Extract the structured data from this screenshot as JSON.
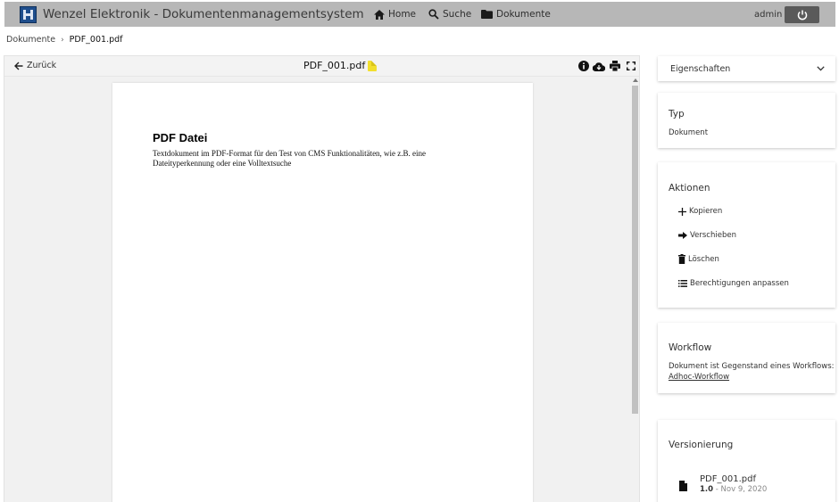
{
  "app": {
    "title": "Wenzel Elektronik - Dokumentenmanagementsystem",
    "nav": {
      "home": "Home",
      "search": "Suche",
      "documents": "Dokumente"
    },
    "user": "admin"
  },
  "breadcrumb": {
    "root": "Dokumente",
    "current": "PDF_001.pdf"
  },
  "viewer": {
    "back_label": "Zurück",
    "file_name": "PDF_001.pdf",
    "pdf": {
      "heading": "PDF Datei",
      "line1": "Textdokument im PDF-Format für den Test von CMS Funktionalitäten, wie z.B. eine",
      "line2": "Dateityperkennung oder eine Volltextsuche"
    }
  },
  "sidebar": {
    "properties_label": "Eigenschaften",
    "type": {
      "title": "Typ",
      "value": "Dokument"
    },
    "actions": {
      "title": "Aktionen",
      "copy": "Kopieren",
      "move": "Verschieben",
      "delete": "Löschen",
      "permissions": "Berechtigungen anpassen"
    },
    "workflow": {
      "title": "Workflow",
      "text": "Dokument ist Gegenstand eines Workflows:",
      "link": "Adhoc-Workflow"
    },
    "versions": {
      "title": "Versionierung",
      "file_name": "PDF_001.pdf",
      "version": "1.0",
      "separator": " - ",
      "date": "Nov 9, 2020"
    }
  },
  "colors": {
    "topbar": "#b7b7b7",
    "power_button": "#5a5a5a",
    "logo": "#1f4e8c",
    "file_badge": "#f2df2e"
  }
}
